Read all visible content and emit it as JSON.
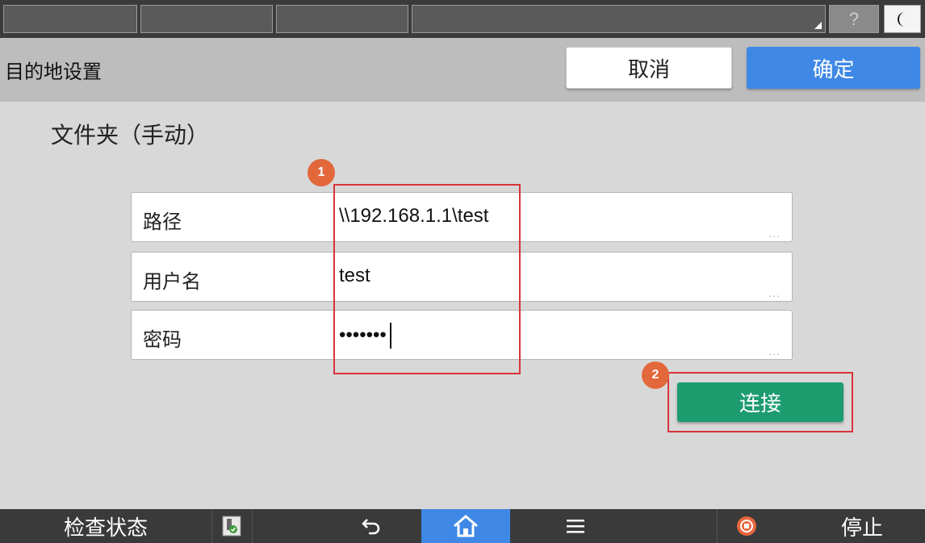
{
  "status_bar": {
    "help_label": "?"
  },
  "header": {
    "title": "目的地设置",
    "cancel_label": "取消",
    "ok_label": "确定"
  },
  "main": {
    "section_title": "文件夹（手动）",
    "fields": [
      {
        "label": "路径",
        "value": "\\\\192.168.1.1\\test",
        "ellipsis": "..."
      },
      {
        "label": "用户名",
        "value": "test",
        "ellipsis": "..."
      },
      {
        "label": "密码",
        "value": "•••••••",
        "ellipsis": "..."
      }
    ],
    "annotations": [
      "1",
      "2"
    ],
    "connect_label": "连接"
  },
  "bottom_bar": {
    "check_status_label": "检查状态",
    "stop_label": "停止"
  },
  "colors": {
    "accent_blue": "#3f88e6",
    "connect_green": "#1d9c70",
    "annotation_red": "#d9333a",
    "badge_orange": "#e2683c",
    "stop_orange": "#e8663c"
  },
  "icons": {
    "help": "question-mark-icon",
    "night_mode": "crescent-moon-icon",
    "usb_status": "usb-check-icon",
    "back": "back-arrow-icon",
    "home": "home-icon",
    "menu": "hamburger-menu-icon",
    "stop": "stop-icon"
  }
}
